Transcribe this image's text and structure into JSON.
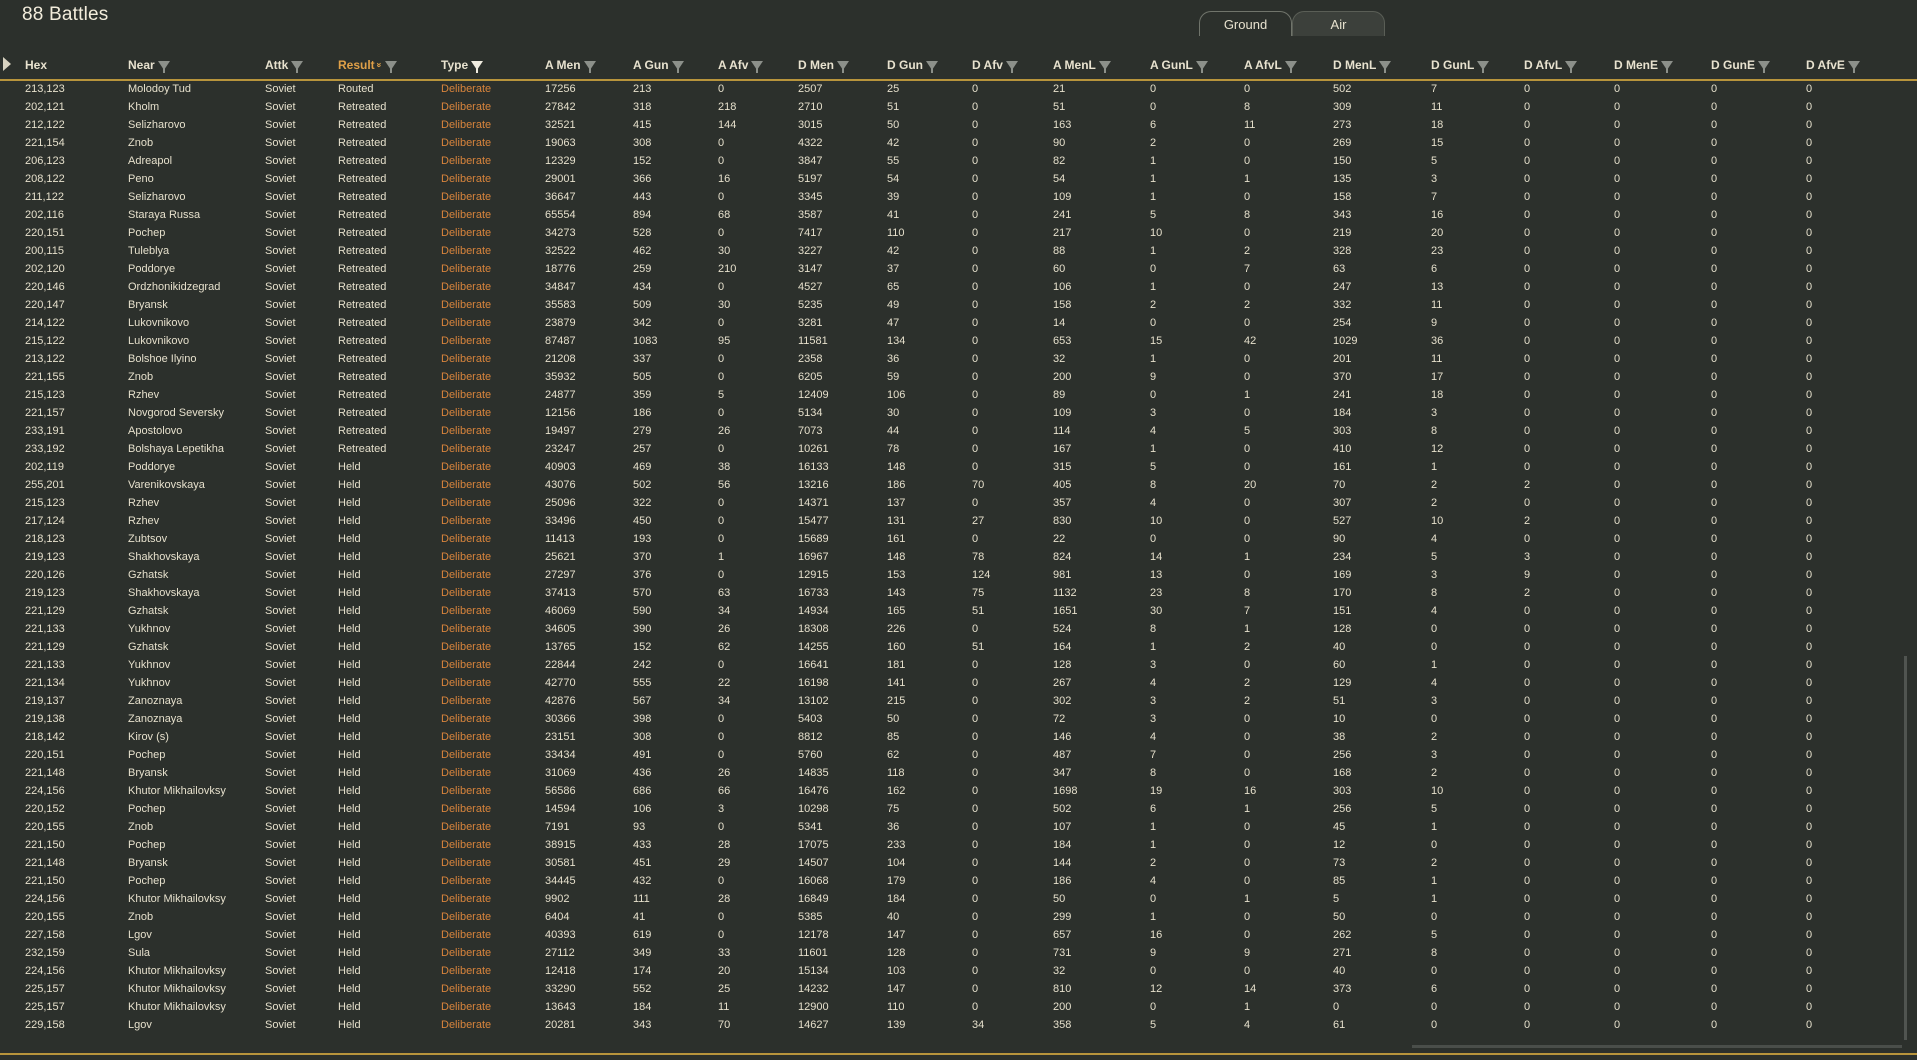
{
  "title": "88 Battles",
  "tabs": [
    {
      "label": "Ground",
      "active": true
    },
    {
      "label": "Air",
      "active": false
    }
  ],
  "accent_color": "#b8943c",
  "type_color": "#d8843c",
  "sorted_header_color": "#e0a048",
  "columns": [
    {
      "key": "hex",
      "label": "Hex",
      "filter": false,
      "sorted": false
    },
    {
      "key": "near",
      "label": "Near",
      "filter": true,
      "sorted": false
    },
    {
      "key": "attk",
      "label": "Attk",
      "filter": true,
      "sorted": false
    },
    {
      "key": "result",
      "label": "Result",
      "filter": true,
      "sorted": true
    },
    {
      "key": "type",
      "label": "Type",
      "filter": true,
      "sorted": false,
      "filter_active": true
    },
    {
      "key": "amen",
      "label": "A Men",
      "filter": true,
      "sorted": false
    },
    {
      "key": "agun",
      "label": "A Gun",
      "filter": true,
      "sorted": false
    },
    {
      "key": "aafv",
      "label": "A Afv",
      "filter": true,
      "sorted": false
    },
    {
      "key": "dmen",
      "label": "D Men",
      "filter": true,
      "sorted": false
    },
    {
      "key": "dgun",
      "label": "D Gun",
      "filter": true,
      "sorted": false
    },
    {
      "key": "dafv",
      "label": "D Afv",
      "filter": true,
      "sorted": false
    },
    {
      "key": "amenl",
      "label": "A MenL",
      "filter": true,
      "sorted": false
    },
    {
      "key": "agunl",
      "label": "A GunL",
      "filter": true,
      "sorted": false
    },
    {
      "key": "aafvl",
      "label": "A AfvL",
      "filter": true,
      "sorted": false
    },
    {
      "key": "dmenl",
      "label": "D MenL",
      "filter": true,
      "sorted": false
    },
    {
      "key": "dgunl",
      "label": "D GunL",
      "filter": true,
      "sorted": false
    },
    {
      "key": "dafvl",
      "label": "D AfvL",
      "filter": true,
      "sorted": false
    },
    {
      "key": "dmene",
      "label": "D MenE",
      "filter": true,
      "sorted": false
    },
    {
      "key": "dgune",
      "label": "D GunE",
      "filter": true,
      "sorted": false
    },
    {
      "key": "dafve",
      "label": "D AfvE",
      "filter": true,
      "sorted": false
    }
  ],
  "rows": [
    [
      "213,123",
      "Molodoy Tud",
      "Soviet",
      "Routed",
      "Deliberate",
      "17256",
      "213",
      "0",
      "2507",
      "25",
      "0",
      "21",
      "0",
      "0",
      "502",
      "7",
      "0",
      "0",
      "0",
      "0"
    ],
    [
      "202,121",
      "Kholm",
      "Soviet",
      "Retreated",
      "Deliberate",
      "27842",
      "318",
      "218",
      "2710",
      "51",
      "0",
      "51",
      "0",
      "8",
      "309",
      "11",
      "0",
      "0",
      "0",
      "0"
    ],
    [
      "212,122",
      "Selizharovo",
      "Soviet",
      "Retreated",
      "Deliberate",
      "32521",
      "415",
      "144",
      "3015",
      "50",
      "0",
      "163",
      "6",
      "11",
      "273",
      "18",
      "0",
      "0",
      "0",
      "0"
    ],
    [
      "221,154",
      "Znob",
      "Soviet",
      "Retreated",
      "Deliberate",
      "19063",
      "308",
      "0",
      "4322",
      "42",
      "0",
      "90",
      "2",
      "0",
      "269",
      "15",
      "0",
      "0",
      "0",
      "0"
    ],
    [
      "206,123",
      "Adreapol",
      "Soviet",
      "Retreated",
      "Deliberate",
      "12329",
      "152",
      "0",
      "3847",
      "55",
      "0",
      "82",
      "1",
      "0",
      "150",
      "5",
      "0",
      "0",
      "0",
      "0"
    ],
    [
      "208,122",
      "Peno",
      "Soviet",
      "Retreated",
      "Deliberate",
      "29001",
      "366",
      "16",
      "5197",
      "54",
      "0",
      "54",
      "1",
      "1",
      "135",
      "3",
      "0",
      "0",
      "0",
      "0"
    ],
    [
      "211,122",
      "Selizharovo",
      "Soviet",
      "Retreated",
      "Deliberate",
      "36647",
      "443",
      "0",
      "3345",
      "39",
      "0",
      "109",
      "1",
      "0",
      "158",
      "7",
      "0",
      "0",
      "0",
      "0"
    ],
    [
      "202,116",
      "Staraya Russa",
      "Soviet",
      "Retreated",
      "Deliberate",
      "65554",
      "894",
      "68",
      "3587",
      "41",
      "0",
      "241",
      "5",
      "8",
      "343",
      "16",
      "0",
      "0",
      "0",
      "0"
    ],
    [
      "220,151",
      "Pochep",
      "Soviet",
      "Retreated",
      "Deliberate",
      "34273",
      "528",
      "0",
      "7417",
      "110",
      "0",
      "217",
      "10",
      "0",
      "219",
      "20",
      "0",
      "0",
      "0",
      "0"
    ],
    [
      "200,115",
      "Tuleblya",
      "Soviet",
      "Retreated",
      "Deliberate",
      "32522",
      "462",
      "30",
      "3227",
      "42",
      "0",
      "88",
      "1",
      "2",
      "328",
      "23",
      "0",
      "0",
      "0",
      "0"
    ],
    [
      "202,120",
      "Poddorye",
      "Soviet",
      "Retreated",
      "Deliberate",
      "18776",
      "259",
      "210",
      "3147",
      "37",
      "0",
      "60",
      "0",
      "7",
      "63",
      "6",
      "0",
      "0",
      "0",
      "0"
    ],
    [
      "220,146",
      "Ordzhonikidzegrad",
      "Soviet",
      "Retreated",
      "Deliberate",
      "34847",
      "434",
      "0",
      "4527",
      "65",
      "0",
      "106",
      "1",
      "0",
      "247",
      "13",
      "0",
      "0",
      "0",
      "0"
    ],
    [
      "220,147",
      "Bryansk",
      "Soviet",
      "Retreated",
      "Deliberate",
      "35583",
      "509",
      "30",
      "5235",
      "49",
      "0",
      "158",
      "2",
      "2",
      "332",
      "11",
      "0",
      "0",
      "0",
      "0"
    ],
    [
      "214,122",
      "Lukovnikovo",
      "Soviet",
      "Retreated",
      "Deliberate",
      "23879",
      "342",
      "0",
      "3281",
      "47",
      "0",
      "14",
      "0",
      "0",
      "254",
      "9",
      "0",
      "0",
      "0",
      "0"
    ],
    [
      "215,122",
      "Lukovnikovo",
      "Soviet",
      "Retreated",
      "Deliberate",
      "87487",
      "1083",
      "95",
      "11581",
      "134",
      "0",
      "653",
      "15",
      "42",
      "1029",
      "36",
      "0",
      "0",
      "0",
      "0"
    ],
    [
      "213,122",
      "Bolshoe Ilyino",
      "Soviet",
      "Retreated",
      "Deliberate",
      "21208",
      "337",
      "0",
      "2358",
      "36",
      "0",
      "32",
      "1",
      "0",
      "201",
      "11",
      "0",
      "0",
      "0",
      "0"
    ],
    [
      "221,155",
      "Znob",
      "Soviet",
      "Retreated",
      "Deliberate",
      "35932",
      "505",
      "0",
      "6205",
      "59",
      "0",
      "200",
      "9",
      "0",
      "370",
      "17",
      "0",
      "0",
      "0",
      "0"
    ],
    [
      "215,123",
      "Rzhev",
      "Soviet",
      "Retreated",
      "Deliberate",
      "24877",
      "359",
      "5",
      "12409",
      "106",
      "0",
      "89",
      "0",
      "1",
      "241",
      "18",
      "0",
      "0",
      "0",
      "0"
    ],
    [
      "221,157",
      "Novgorod Seversky",
      "Soviet",
      "Retreated",
      "Deliberate",
      "12156",
      "186",
      "0",
      "5134",
      "30",
      "0",
      "109",
      "3",
      "0",
      "184",
      "3",
      "0",
      "0",
      "0",
      "0"
    ],
    [
      "233,191",
      "Apostolovo",
      "Soviet",
      "Retreated",
      "Deliberate",
      "19497",
      "279",
      "26",
      "7073",
      "44",
      "0",
      "114",
      "4",
      "5",
      "303",
      "8",
      "0",
      "0",
      "0",
      "0"
    ],
    [
      "233,192",
      "Bolshaya Lepetikha",
      "Soviet",
      "Retreated",
      "Deliberate",
      "23247",
      "257",
      "0",
      "10261",
      "78",
      "0",
      "167",
      "1",
      "0",
      "410",
      "12",
      "0",
      "0",
      "0",
      "0"
    ],
    [
      "202,119",
      "Poddorye",
      "Soviet",
      "Held",
      "Deliberate",
      "40903",
      "469",
      "38",
      "16133",
      "148",
      "0",
      "315",
      "5",
      "0",
      "161",
      "1",
      "0",
      "0",
      "0",
      "0"
    ],
    [
      "255,201",
      "Varenikovskaya",
      "Soviet",
      "Held",
      "Deliberate",
      "43076",
      "502",
      "56",
      "13216",
      "186",
      "70",
      "405",
      "8",
      "20",
      "70",
      "2",
      "2",
      "0",
      "0",
      "0"
    ],
    [
      "215,123",
      "Rzhev",
      "Soviet",
      "Held",
      "Deliberate",
      "25096",
      "322",
      "0",
      "14371",
      "137",
      "0",
      "357",
      "4",
      "0",
      "307",
      "2",
      "0",
      "0",
      "0",
      "0"
    ],
    [
      "217,124",
      "Rzhev",
      "Soviet",
      "Held",
      "Deliberate",
      "33496",
      "450",
      "0",
      "15477",
      "131",
      "27",
      "830",
      "10",
      "0",
      "527",
      "10",
      "2",
      "0",
      "0",
      "0"
    ],
    [
      "218,123",
      "Zubtsov",
      "Soviet",
      "Held",
      "Deliberate",
      "11413",
      "193",
      "0",
      "15689",
      "161",
      "0",
      "22",
      "0",
      "0",
      "90",
      "4",
      "0",
      "0",
      "0",
      "0"
    ],
    [
      "219,123",
      "Shakhovskaya",
      "Soviet",
      "Held",
      "Deliberate",
      "25621",
      "370",
      "1",
      "16967",
      "148",
      "78",
      "824",
      "14",
      "1",
      "234",
      "5",
      "3",
      "0",
      "0",
      "0"
    ],
    [
      "220,126",
      "Gzhatsk",
      "Soviet",
      "Held",
      "Deliberate",
      "27297",
      "376",
      "0",
      "12915",
      "153",
      "124",
      "981",
      "13",
      "0",
      "169",
      "3",
      "9",
      "0",
      "0",
      "0"
    ],
    [
      "219,123",
      "Shakhovskaya",
      "Soviet",
      "Held",
      "Deliberate",
      "37413",
      "570",
      "63",
      "16733",
      "143",
      "75",
      "1132",
      "23",
      "8",
      "170",
      "8",
      "2",
      "0",
      "0",
      "0"
    ],
    [
      "221,129",
      "Gzhatsk",
      "Soviet",
      "Held",
      "Deliberate",
      "46069",
      "590",
      "34",
      "14934",
      "165",
      "51",
      "1651",
      "30",
      "7",
      "151",
      "4",
      "0",
      "0",
      "0",
      "0"
    ],
    [
      "221,133",
      "Yukhnov",
      "Soviet",
      "Held",
      "Deliberate",
      "34605",
      "390",
      "26",
      "18308",
      "226",
      "0",
      "524",
      "8",
      "1",
      "128",
      "0",
      "0",
      "0",
      "0",
      "0"
    ],
    [
      "221,129",
      "Gzhatsk",
      "Soviet",
      "Held",
      "Deliberate",
      "13765",
      "152",
      "62",
      "14255",
      "160",
      "51",
      "164",
      "1",
      "2",
      "40",
      "0",
      "0",
      "0",
      "0",
      "0"
    ],
    [
      "221,133",
      "Yukhnov",
      "Soviet",
      "Held",
      "Deliberate",
      "22844",
      "242",
      "0",
      "16641",
      "181",
      "0",
      "128",
      "3",
      "0",
      "60",
      "1",
      "0",
      "0",
      "0",
      "0"
    ],
    [
      "221,134",
      "Yukhnov",
      "Soviet",
      "Held",
      "Deliberate",
      "42770",
      "555",
      "22",
      "16198",
      "141",
      "0",
      "267",
      "4",
      "2",
      "129",
      "4",
      "0",
      "0",
      "0",
      "0"
    ],
    [
      "219,137",
      "Zanoznaya",
      "Soviet",
      "Held",
      "Deliberate",
      "42876",
      "567",
      "34",
      "13102",
      "215",
      "0",
      "302",
      "3",
      "2",
      "51",
      "3",
      "0",
      "0",
      "0",
      "0"
    ],
    [
      "219,138",
      "Zanoznaya",
      "Soviet",
      "Held",
      "Deliberate",
      "30366",
      "398",
      "0",
      "5403",
      "50",
      "0",
      "72",
      "3",
      "0",
      "10",
      "0",
      "0",
      "0",
      "0",
      "0"
    ],
    [
      "218,142",
      "Kirov (s)",
      "Soviet",
      "Held",
      "Deliberate",
      "23151",
      "308",
      "0",
      "8812",
      "85",
      "0",
      "146",
      "4",
      "0",
      "38",
      "2",
      "0",
      "0",
      "0",
      "0"
    ],
    [
      "220,151",
      "Pochep",
      "Soviet",
      "Held",
      "Deliberate",
      "33434",
      "491",
      "0",
      "5760",
      "62",
      "0",
      "487",
      "7",
      "0",
      "256",
      "3",
      "0",
      "0",
      "0",
      "0"
    ],
    [
      "221,148",
      "Bryansk",
      "Soviet",
      "Held",
      "Deliberate",
      "31069",
      "436",
      "26",
      "14835",
      "118",
      "0",
      "347",
      "8",
      "0",
      "168",
      "2",
      "0",
      "0",
      "0",
      "0"
    ],
    [
      "224,156",
      "Khutor Mikhailovksy",
      "Soviet",
      "Held",
      "Deliberate",
      "56586",
      "686",
      "66",
      "16476",
      "162",
      "0",
      "1698",
      "19",
      "16",
      "303",
      "10",
      "0",
      "0",
      "0",
      "0"
    ],
    [
      "220,152",
      "Pochep",
      "Soviet",
      "Held",
      "Deliberate",
      "14594",
      "106",
      "3",
      "10298",
      "75",
      "0",
      "502",
      "6",
      "1",
      "256",
      "5",
      "0",
      "0",
      "0",
      "0"
    ],
    [
      "220,155",
      "Znob",
      "Soviet",
      "Held",
      "Deliberate",
      "7191",
      "93",
      "0",
      "5341",
      "36",
      "0",
      "107",
      "1",
      "0",
      "45",
      "1",
      "0",
      "0",
      "0",
      "0"
    ],
    [
      "221,150",
      "Pochep",
      "Soviet",
      "Held",
      "Deliberate",
      "38915",
      "433",
      "28",
      "17075",
      "233",
      "0",
      "184",
      "1",
      "0",
      "12",
      "0",
      "0",
      "0",
      "0",
      "0"
    ],
    [
      "221,148",
      "Bryansk",
      "Soviet",
      "Held",
      "Deliberate",
      "30581",
      "451",
      "29",
      "14507",
      "104",
      "0",
      "144",
      "2",
      "0",
      "73",
      "2",
      "0",
      "0",
      "0",
      "0"
    ],
    [
      "221,150",
      "Pochep",
      "Soviet",
      "Held",
      "Deliberate",
      "34445",
      "432",
      "0",
      "16068",
      "179",
      "0",
      "186",
      "4",
      "0",
      "85",
      "1",
      "0",
      "0",
      "0",
      "0"
    ],
    [
      "224,156",
      "Khutor Mikhailovksy",
      "Soviet",
      "Held",
      "Deliberate",
      "9902",
      "111",
      "28",
      "16849",
      "184",
      "0",
      "50",
      "0",
      "1",
      "5",
      "1",
      "0",
      "0",
      "0",
      "0"
    ],
    [
      "220,155",
      "Znob",
      "Soviet",
      "Held",
      "Deliberate",
      "6404",
      "41",
      "0",
      "5385",
      "40",
      "0",
      "299",
      "1",
      "0",
      "50",
      "0",
      "0",
      "0",
      "0",
      "0"
    ],
    [
      "227,158",
      "Lgov",
      "Soviet",
      "Held",
      "Deliberate",
      "40393",
      "619",
      "0",
      "12178",
      "147",
      "0",
      "657",
      "16",
      "0",
      "262",
      "5",
      "0",
      "0",
      "0",
      "0"
    ],
    [
      "232,159",
      "Sula",
      "Soviet",
      "Held",
      "Deliberate",
      "27112",
      "349",
      "33",
      "11601",
      "128",
      "0",
      "731",
      "9",
      "9",
      "271",
      "8",
      "0",
      "0",
      "0",
      "0"
    ],
    [
      "224,156",
      "Khutor Mikhailovksy",
      "Soviet",
      "Held",
      "Deliberate",
      "12418",
      "174",
      "20",
      "15134",
      "103",
      "0",
      "32",
      "0",
      "0",
      "40",
      "0",
      "0",
      "0",
      "0",
      "0"
    ],
    [
      "225,157",
      "Khutor Mikhailovksy",
      "Soviet",
      "Held",
      "Deliberate",
      "33290",
      "552",
      "25",
      "14232",
      "147",
      "0",
      "810",
      "12",
      "14",
      "373",
      "6",
      "0",
      "0",
      "0",
      "0"
    ],
    [
      "225,157",
      "Khutor Mikhailovksy",
      "Soviet",
      "Held",
      "Deliberate",
      "13643",
      "184",
      "11",
      "12900",
      "110",
      "0",
      "200",
      "0",
      "1",
      "0",
      "0",
      "0",
      "0",
      "0",
      "0"
    ],
    [
      "229,158",
      "Lgov",
      "Soviet",
      "Held",
      "Deliberate",
      "20281",
      "343",
      "70",
      "14627",
      "139",
      "34",
      "358",
      "5",
      "4",
      "61",
      "0",
      "0",
      "0",
      "0",
      "0"
    ]
  ]
}
